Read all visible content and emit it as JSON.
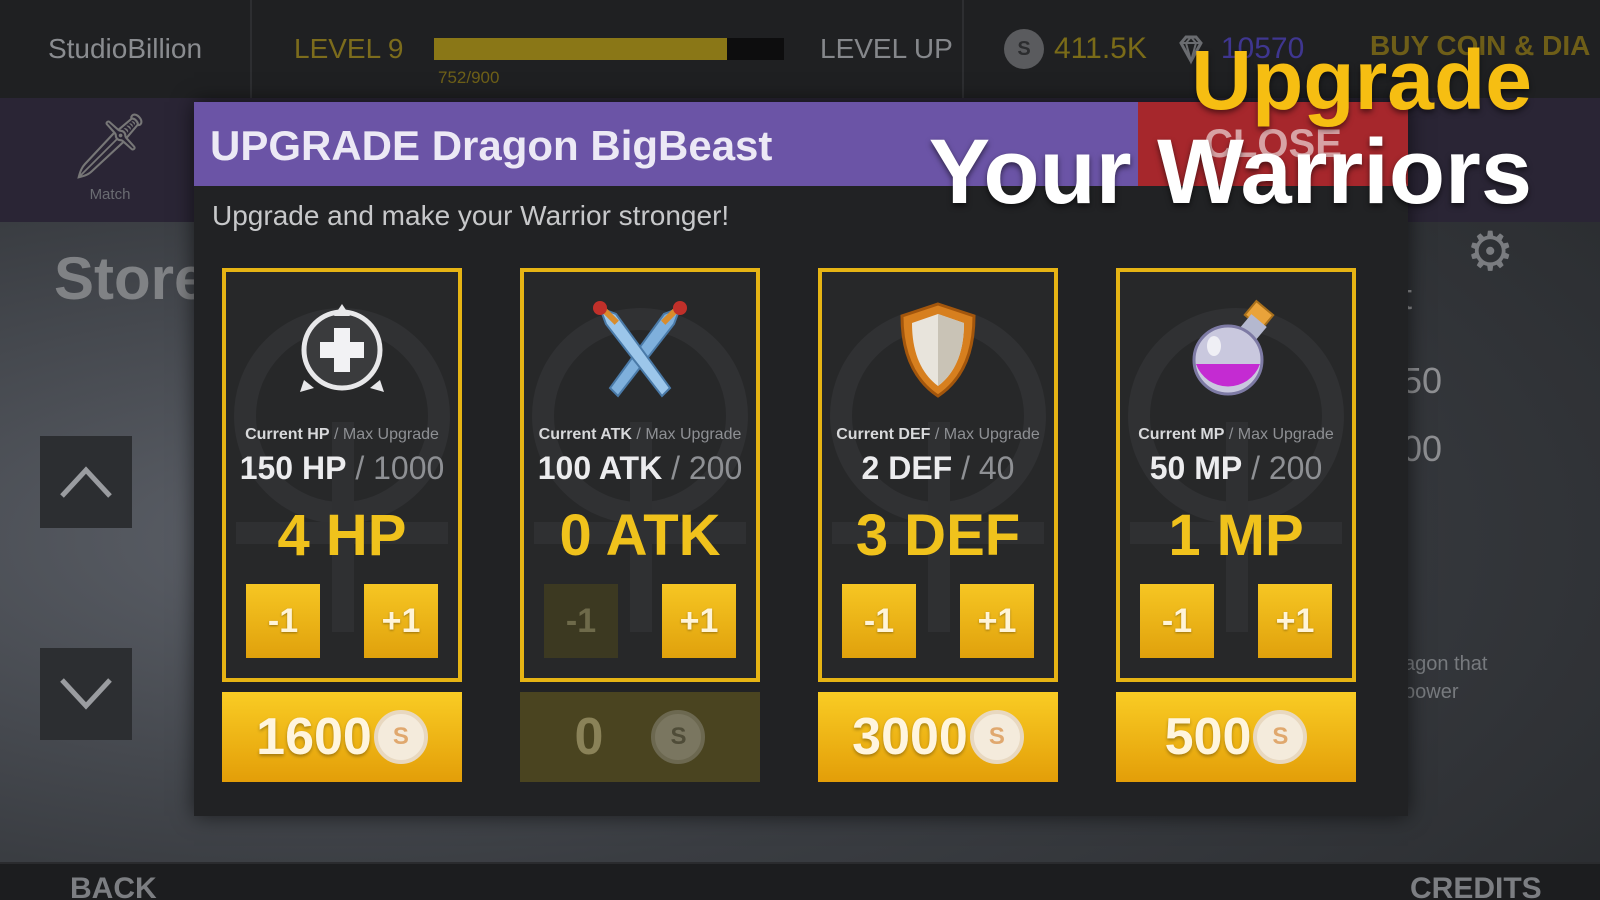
{
  "topbar": {
    "studio": "StudioBillion",
    "level": "LEVEL 9",
    "xp_text": "752/900",
    "xp_progress": 0.836,
    "level_up": "LEVEL UP",
    "coin_symbol": "S",
    "coins": "411.5K",
    "diamonds": "10570",
    "buy": "BUY COIN & DIA"
  },
  "nav": {
    "match_label": "Match",
    "store_title": "Store",
    "up": "^",
    "down": "v"
  },
  "bg_right": {
    "t1": "t",
    "t2": "50",
    "t3": "00",
    "small1": "agon that",
    "small2": "power"
  },
  "modal": {
    "title": "UPGRADE Dragon BigBeast",
    "close": "CLOSE",
    "subtitle": "Upgrade and make your Warrior stronger!",
    "cards": [
      {
        "icon": "health-plus-icon",
        "label_cur": "Current HP",
        "label_max": "/ Max Upgrade",
        "cur": "150 HP",
        "max": "/ 1000",
        "upgrade": "4 HP",
        "minus": "-1",
        "plus": "+1",
        "price": "1600",
        "minus_enabled": true,
        "buy_enabled": true
      },
      {
        "icon": "crossed-swords-icon",
        "label_cur": "Current ATK",
        "label_max": "/ Max Upgrade",
        "cur": "100 ATK",
        "max": "/ 200",
        "upgrade": "0 ATK",
        "minus": "-1",
        "plus": "+1",
        "price": "0",
        "minus_enabled": false,
        "buy_enabled": false
      },
      {
        "icon": "shield-icon",
        "label_cur": "Current DEF",
        "label_max": "/ Max Upgrade",
        "cur": "2 DEF",
        "max": "/ 40",
        "upgrade": "3 DEF",
        "minus": "-1",
        "plus": "+1",
        "price": "3000",
        "minus_enabled": true,
        "buy_enabled": true
      },
      {
        "icon": "potion-icon",
        "label_cur": "Current MP",
        "label_max": "/ Max Upgrade",
        "cur": "50 MP",
        "max": "/ 200",
        "upgrade": "1 MP",
        "minus": "-1",
        "plus": "+1",
        "price": "500",
        "minus_enabled": true,
        "buy_enabled": true
      }
    ]
  },
  "bottombar": {
    "back": "BACK",
    "credits": "CREDITS"
  },
  "promo": {
    "line1": "Upgrade",
    "line2": "Your Warriors"
  },
  "colors": {
    "accent_gold": "#f0c21c",
    "header_purple": "#6b54a6",
    "close_red": "#a6272c"
  }
}
